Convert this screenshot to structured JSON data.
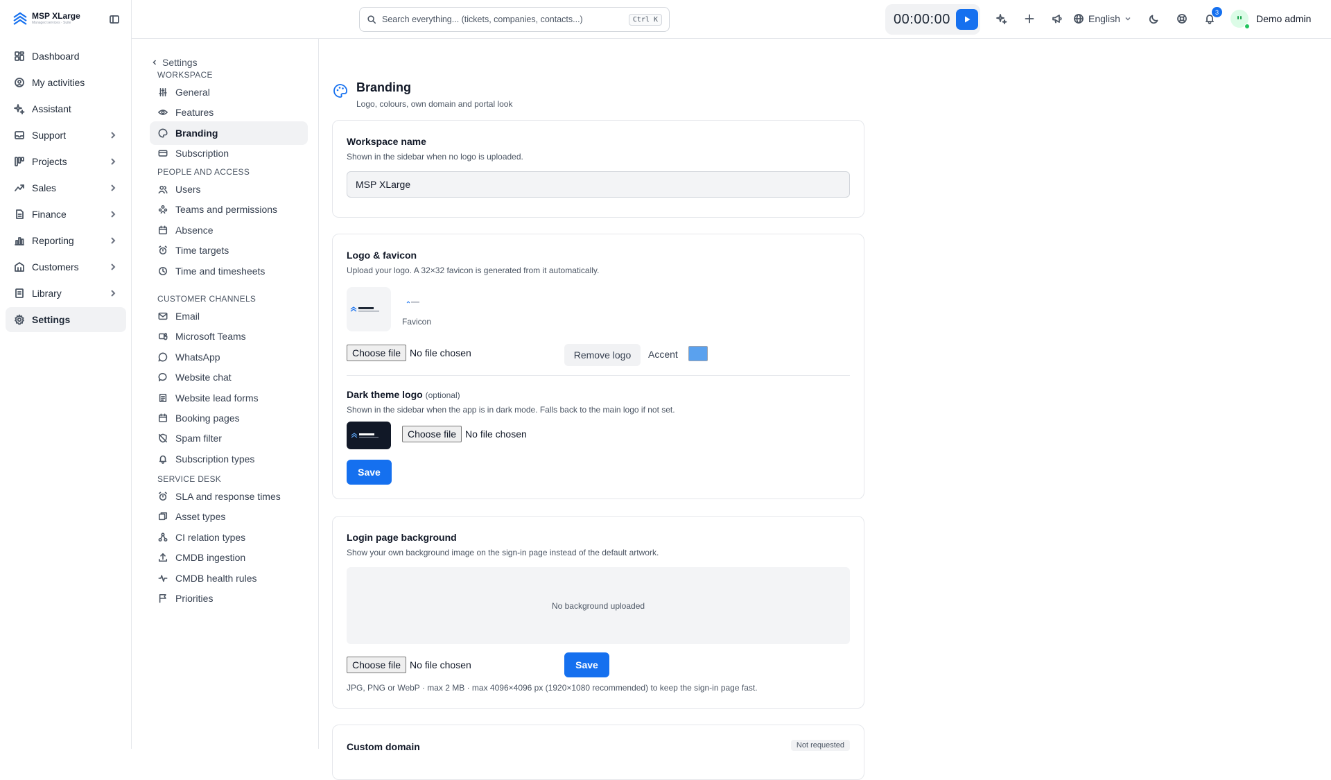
{
  "app": {
    "name": "MSP XLarge",
    "tagline": "Managed services · Suite"
  },
  "search": {
    "placeholder": "Search everything... (tickets, companies, contacts...)",
    "shortcut": "Ctrl K"
  },
  "timer": {
    "value": "00:00:00"
  },
  "topbar": {
    "language": "English",
    "notifications_count": "3",
    "user_name": "Demo admin"
  },
  "sidebar": {
    "items": [
      {
        "label": "Dashboard",
        "icon": "dashboard-icon"
      },
      {
        "label": "My activities",
        "icon": "activity-icon"
      },
      {
        "label": "Assistant",
        "icon": "sparkle-icon"
      },
      {
        "label": "Support",
        "icon": "support-icon"
      },
      {
        "label": "Projects",
        "icon": "projects-icon"
      },
      {
        "label": "Sales",
        "icon": "sales-icon"
      },
      {
        "label": "Finance",
        "icon": "finance-icon"
      },
      {
        "label": "Reporting",
        "icon": "reporting-icon"
      },
      {
        "label": "Customers",
        "icon": "customers-icon"
      },
      {
        "label": "Library",
        "icon": "library-icon"
      },
      {
        "label": "Settings",
        "icon": "gear-icon"
      }
    ]
  },
  "settings_nav": {
    "back_label": "Settings",
    "sections": [
      {
        "title": "WORKSPACE",
        "items": [
          "General",
          "Features",
          "Branding",
          "Subscription"
        ]
      },
      {
        "title": "PEOPLE AND ACCESS",
        "items": [
          "Users",
          "Teams and permissions",
          "Absence",
          "Time targets",
          "Time and timesheets"
        ]
      },
      {
        "title": "CUSTOMER CHANNELS",
        "items": [
          "Email",
          "Microsoft Teams",
          "WhatsApp",
          "Website chat",
          "Website lead forms",
          "Booking pages",
          "Spam filter",
          "Subscription types"
        ]
      },
      {
        "title": "SERVICE DESK",
        "items": [
          "SLA and response times",
          "Asset types",
          "CI relation types",
          "CMDB ingestion",
          "CMDB health rules",
          "Priorities"
        ]
      }
    ]
  },
  "page": {
    "title": "Branding",
    "subtitle": "Logo, colours, own domain and portal look"
  },
  "workspace_card": {
    "title": "Workspace name",
    "desc": "Shown in the sidebar when no logo is uploaded.",
    "value": "MSP XLarge"
  },
  "logo_card": {
    "title": "Logo & favicon",
    "desc": "Upload your logo. A 32×32 favicon is generated from it automatically.",
    "favicon_label": "Favicon",
    "choose_file": "Choose file",
    "no_file": "No file chosen",
    "remove_logo": "Remove logo",
    "accent_label": "Accent",
    "accent_color": "#5aa1ee",
    "dark_title": "Dark theme logo",
    "dark_optional": "(optional)",
    "dark_desc": "Shown in the sidebar when the app is in dark mode. Falls back to the main logo if not set.",
    "save": "Save"
  },
  "login_card": {
    "title": "Login page background",
    "desc": "Show your own background image on the sign-in page instead of the default artwork.",
    "empty": "No background uploaded",
    "choose_file": "Choose file",
    "no_file": "No file chosen",
    "save": "Save",
    "hint": "JPG, PNG or WebP · max 2 MB · max 4096×4096 px (1920×1080 recommended) to keep the sign-in page fast."
  },
  "domain_card": {
    "title": "Custom domain",
    "status": "Not requested"
  }
}
